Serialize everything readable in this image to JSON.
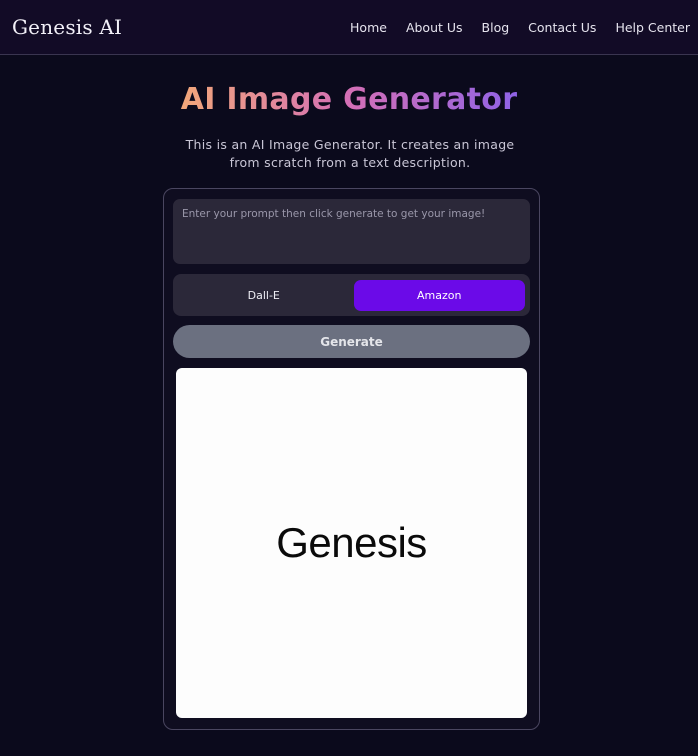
{
  "nav": {
    "brand": "Genesis AI",
    "links": [
      "Home",
      "About Us",
      "Blog",
      "Contact Us",
      "Help Center"
    ]
  },
  "hero": {
    "title": "AI Image Generator",
    "subtitle": "This is an AI Image Generator. It creates an image from scratch from a text description."
  },
  "form": {
    "prompt_placeholder": "Enter your prompt then click generate to get your image!",
    "prompt_value": "",
    "providers": [
      {
        "label": "Dall-E",
        "selected": false
      },
      {
        "label": "Amazon",
        "selected": true
      }
    ],
    "generate_label": "Generate"
  },
  "result": {
    "logo_text": "Genesis"
  },
  "colors": {
    "accent": "#6b0ae8",
    "background": "#0b0a1c",
    "navbar": "#120b26",
    "panel": "#2b2839",
    "generate_button": "#6b7080"
  }
}
